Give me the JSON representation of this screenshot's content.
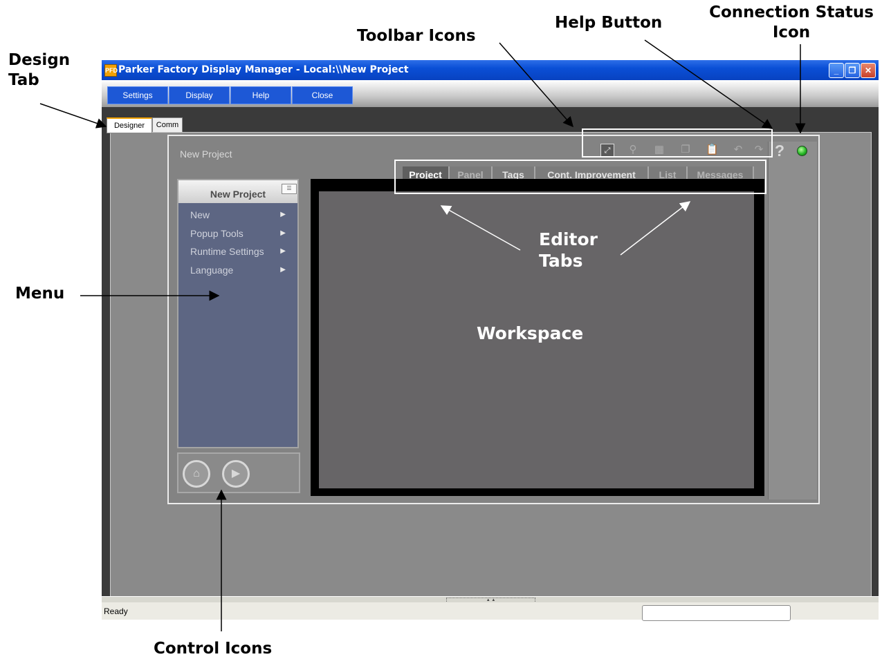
{
  "callouts": {
    "design_tab": "Design\nTab",
    "toolbar_icons": "Toolbar Icons",
    "help_button": "Help Button",
    "connection_status": "Connection Status\nIcon",
    "menu": "Menu",
    "control_icons": "Control Icons",
    "editor_tabs": "Editor\nTabs",
    "workspace": "Workspace"
  },
  "window": {
    "title": "Parker Factory Display Manager - Local:\\\\New Project",
    "app_icon": "PFD",
    "minimize": "_",
    "restore": "❐",
    "close": "✕"
  },
  "menubar": [
    "Settings",
    "Display",
    "Help",
    "Close"
  ],
  "design_tabs": [
    "Designer",
    "Comm"
  ],
  "project_title": "New Project",
  "toolbar": {
    "icons": [
      "fit-to-screen",
      "zoom",
      "grid",
      "copy",
      "paste",
      "undo",
      "redo"
    ],
    "help_label": "?"
  },
  "editor_tabs": [
    "Project",
    "Panel",
    "Tags",
    "Cont. Improvement",
    "List",
    "Messages"
  ],
  "menu_panel": {
    "header": "New Project",
    "items": [
      "New",
      "Popup Tools",
      "Runtime Settings",
      "Language"
    ]
  },
  "statusbar": {
    "text": "Ready"
  },
  "colors": {
    "titlebar": "#0a4fd6",
    "menu_button": "#1d58d6",
    "menu_panel": "#5d6683",
    "workspace": "#676567",
    "status_led": "#27b727"
  }
}
